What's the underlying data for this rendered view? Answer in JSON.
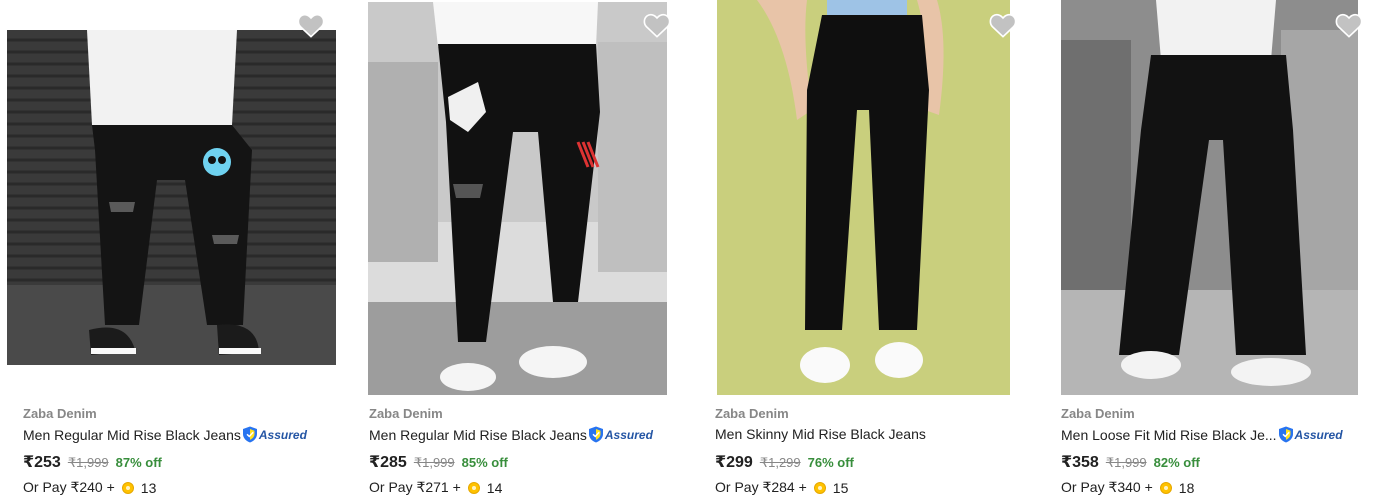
{
  "products": [
    {
      "brand": "Zaba Denim",
      "title": "Men Regular Mid Rise Black Jeans",
      "assured": true,
      "assured_label": "Assured",
      "price": "₹253",
      "mrp": "₹1,999",
      "discount": "87% off",
      "pay_prefix": "Or Pay ₹240 +",
      "coins": "13",
      "image_icon": "product-image"
    },
    {
      "brand": "Zaba Denim",
      "title": "Men Regular Mid Rise Black Jeans",
      "assured": true,
      "assured_label": "Assured",
      "price": "₹285",
      "mrp": "₹1,999",
      "discount": "85% off",
      "pay_prefix": "Or Pay ₹271 +",
      "coins": "14",
      "image_icon": "product-image"
    },
    {
      "brand": "Zaba Denim",
      "title": "Men Skinny Mid Rise Black Jeans",
      "assured": false,
      "price": "₹299",
      "mrp": "₹1,299",
      "discount": "76% off",
      "pay_prefix": "Or Pay ₹284 +",
      "coins": "15",
      "image_icon": "product-image"
    },
    {
      "brand": "Zaba Denim",
      "title": "Men Loose Fit Mid Rise Black Je...",
      "assured": true,
      "assured_label": "Assured",
      "price": "₹358",
      "mrp": "₹1,999",
      "discount": "82% off",
      "pay_prefix": "Or Pay ₹340 +",
      "coins": "18",
      "image_icon": "product-image"
    }
  ],
  "colors": {
    "price_discount": "#388e3c",
    "assured_blue": "#2455a4",
    "muted_text": "#878787",
    "coin": "#ffc200"
  },
  "icons": {
    "wishlist": "heart-icon",
    "assured": "assured-shield-icon",
    "coin": "supercoin-icon"
  }
}
